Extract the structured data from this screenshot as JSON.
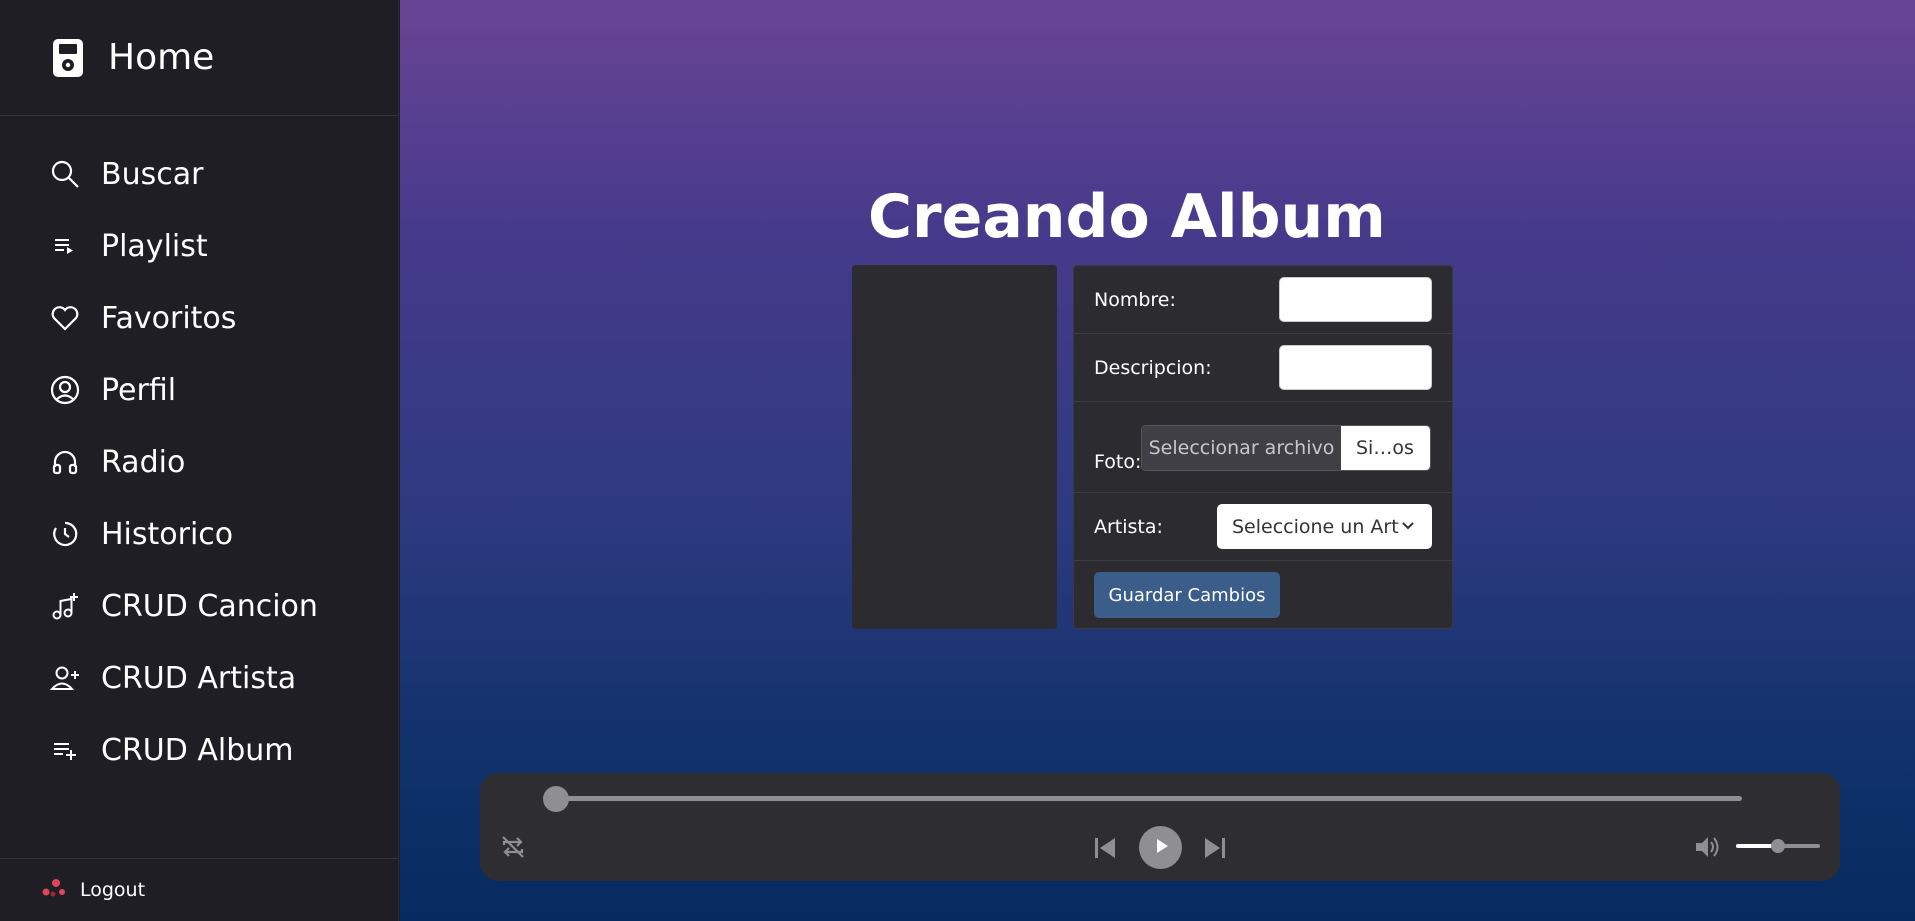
{
  "sidebar": {
    "brand": {
      "label": "Home",
      "icon": "ipod-icon"
    },
    "items": [
      {
        "label": "Buscar",
        "icon": "search-icon"
      },
      {
        "label": "Playlist",
        "icon": "playlist-icon"
      },
      {
        "label": "Favoritos",
        "icon": "heart-icon"
      },
      {
        "label": "Perfil",
        "icon": "user-circle-icon"
      },
      {
        "label": "Radio",
        "icon": "headphones-icon"
      },
      {
        "label": "Historico",
        "icon": "history-icon"
      },
      {
        "label": "CRUD Cancion",
        "icon": "music-plus-icon"
      },
      {
        "label": "CRUD Artista",
        "icon": "person-plus-icon"
      },
      {
        "label": "CRUD Album",
        "icon": "list-plus-icon"
      }
    ],
    "logout": {
      "label": "Logout",
      "icon": "logout-icon"
    }
  },
  "main": {
    "title": "Creando Album",
    "form": {
      "nombre_label": "Nombre:",
      "nombre_value": "",
      "descripcion_label": "Descripcion:",
      "descripcion_value": "",
      "foto_label": "Foto:",
      "foto_button": "Seleccionar archivo",
      "foto_filename": "Si…os",
      "artista_label": "Artista:",
      "artista_selected": "Seleccione un Art",
      "save_label": "Guardar Cambios"
    }
  },
  "player": {
    "progress": 0.0,
    "volume": 0.5,
    "icons": [
      "repeat-icon",
      "skip-previous-icon",
      "play-icon",
      "skip-next-icon",
      "volume-icon"
    ]
  },
  "colors": {
    "sidebar_bg": "#1f1e24",
    "card_bg": "#2c2b30",
    "save_button": "#3b5d89",
    "logout_accent": "#e0455a"
  }
}
